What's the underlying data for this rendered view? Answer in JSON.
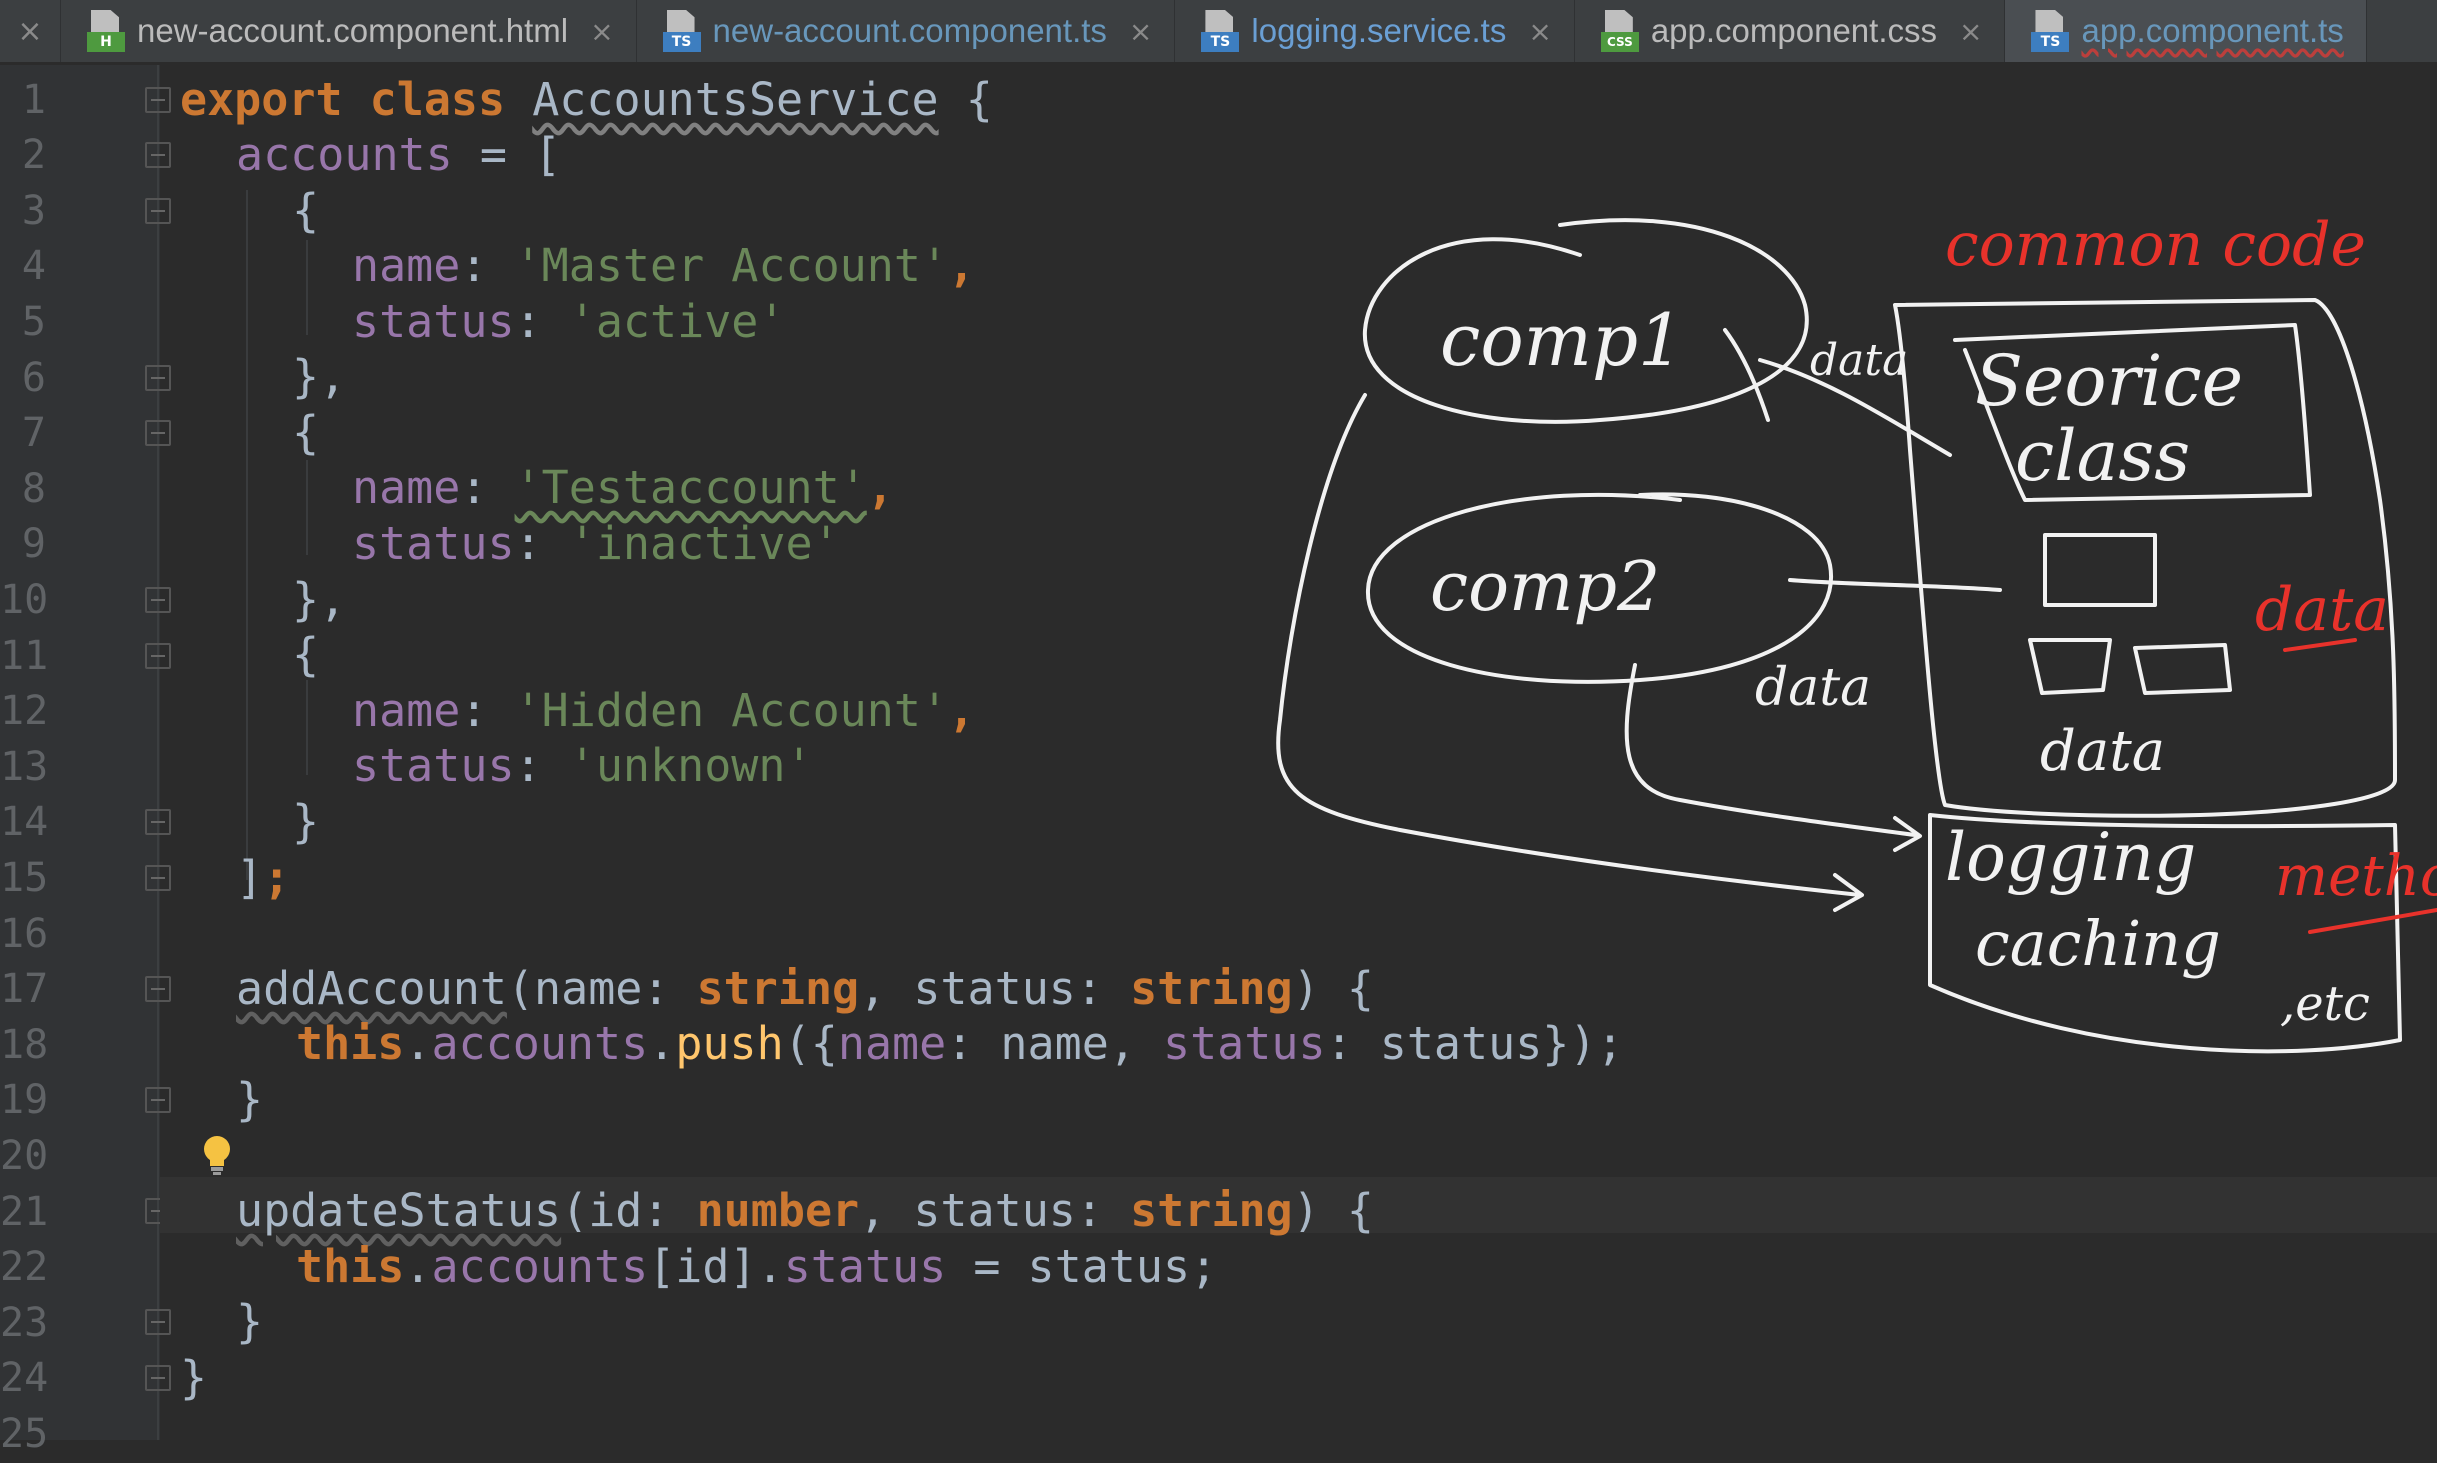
{
  "tabs": [
    {
      "label": "new-account.component.html",
      "badge": "H",
      "badge_color": "#4e9a3f",
      "state": "normal"
    },
    {
      "label": "new-account.component.ts",
      "badge": "TS",
      "badge_color": "#3d7ec0",
      "state": "modified"
    },
    {
      "label": "logging.service.ts",
      "badge": "TS",
      "badge_color": "#3d7ec0",
      "state": "modified"
    },
    {
      "label": "app.component.css",
      "badge": "CSS",
      "badge_color": "#4e9a3f",
      "state": "normal"
    },
    {
      "label": "app.component.ts",
      "badge": "TS",
      "badge_color": "#3d7ec0",
      "state": "active"
    }
  ],
  "editor": {
    "line_numbers": [
      "1",
      "2",
      "3",
      "4",
      "5",
      "6",
      "7",
      "8",
      "9",
      "10",
      "11",
      "12",
      "13",
      "14",
      "15",
      "16",
      "17",
      "18",
      "19",
      "20",
      "21",
      "22",
      "23",
      "24",
      "25"
    ],
    "tokens": {
      "l1": [
        "export",
        "class",
        "AccountsService",
        " {"
      ],
      "l2": [
        "accounts",
        " = ["
      ],
      "l3": "{",
      "l4": [
        "name",
        ": ",
        "'Master Account'",
        ","
      ],
      "l5": [
        "status",
        ": ",
        "'active'"
      ],
      "l6": "},",
      "l7": "{",
      "l8": [
        "name",
        ": ",
        "'Testaccount'",
        ","
      ],
      "l9": [
        "status",
        ": ",
        "'inactive'"
      ],
      "l10": "},",
      "l11": "{",
      "l12": [
        "name",
        ": ",
        "'Hidden Account'",
        ","
      ],
      "l13": [
        "status",
        ": ",
        "'unknown'"
      ],
      "l14": "}",
      "l15": [
        "]",
        ";"
      ],
      "l17": [
        "addAccount",
        "(name: ",
        "string",
        ", status: ",
        "string",
        ") {"
      ],
      "l18": [
        "this",
        ".",
        "accounts",
        ".",
        "push",
        "({",
        "name",
        ": name, ",
        "status",
        ": status});"
      ],
      "l19": "}",
      "l21": [
        "updateStatus",
        "(id: ",
        "number",
        ", status: ",
        "string",
        ") {"
      ],
      "l22": [
        "this",
        ".",
        "accounts",
        "[id].",
        "status",
        " = status;"
      ],
      "l23": "}",
      "l24": "}"
    }
  },
  "annotations": {
    "white": {
      "comp1": "comp1",
      "comp2": "comp2",
      "service_line1": "Seorice",
      "service_line2": "class",
      "data_a": "data",
      "data_b": "data",
      "data_c": "data",
      "logging": "logging",
      "caching": "caching",
      "etc": ",etc"
    },
    "red": {
      "common_code": "common code",
      "data": "data",
      "methods": "methods"
    },
    "colors": {
      "white_ink": "#f2f2f2",
      "red_ink": "#e8322b"
    }
  }
}
